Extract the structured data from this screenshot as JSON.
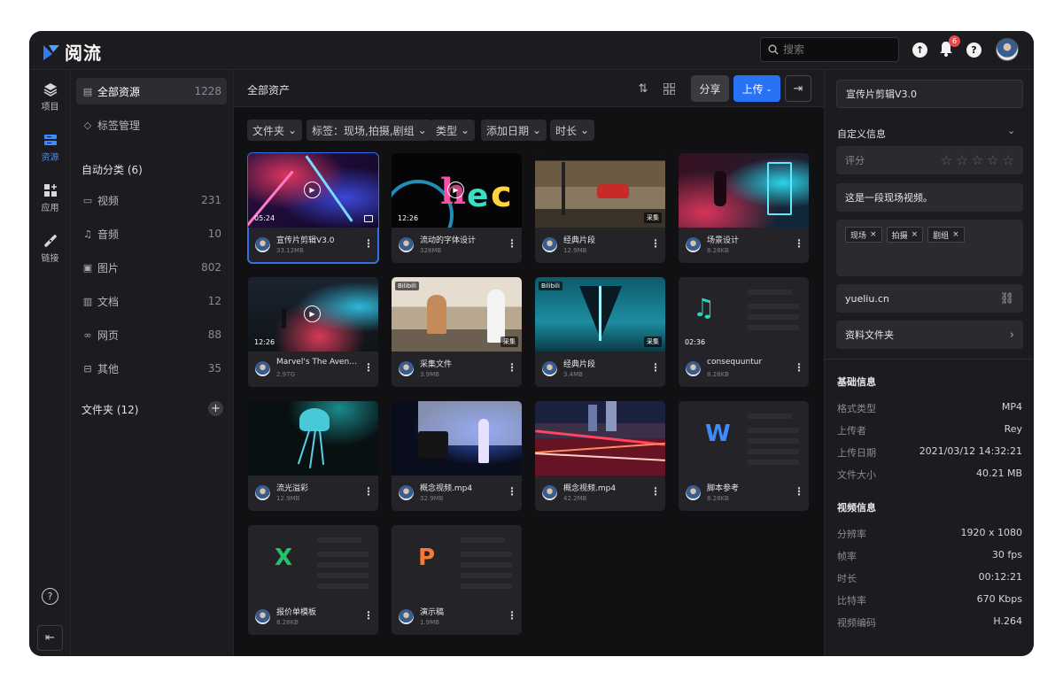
{
  "app": {
    "name": "阅流"
  },
  "topbar": {
    "search_placeholder": "搜索",
    "notification_count": "6"
  },
  "nav": {
    "items": [
      {
        "label": "项目",
        "icon": "layers-icon"
      },
      {
        "label": "资源",
        "icon": "folder-icon"
      },
      {
        "label": "应用",
        "icon": "apps-icon"
      },
      {
        "label": "链接",
        "icon": "link-icon"
      }
    ]
  },
  "sidebar": {
    "all": {
      "label": "全部资源",
      "count": "1228"
    },
    "tags": {
      "label": "标签管理"
    },
    "auto_title": "自动分类 (6)",
    "categories": [
      {
        "label": "视频",
        "count": "231"
      },
      {
        "label": "音频",
        "count": "10"
      },
      {
        "label": "图片",
        "count": "802"
      },
      {
        "label": "文档",
        "count": "12"
      },
      {
        "label": "网页",
        "count": "88"
      },
      {
        "label": "其他",
        "count": "35"
      }
    ],
    "folder_title": "文件夹 (12)"
  },
  "main": {
    "title": "全部资产",
    "share": "分享",
    "upload": "上传",
    "filters": [
      "文件夹",
      "标签：现场,拍摄,剧组",
      "类型",
      "添加日期",
      "时长"
    ],
    "cards": [
      {
        "name": "宣传片剪辑V3.0",
        "size": "33.12MB",
        "duration": "05:24"
      },
      {
        "name": "流动的字体设计",
        "size": "328MB",
        "duration": "12:26"
      },
      {
        "name": "经典片段",
        "size": "12.9MB",
        "badge": "采集"
      },
      {
        "name": "场景设计",
        "size": "8.28KB"
      },
      {
        "name": "Marvel's The Avengers",
        "size": "2.97G",
        "duration": "12:26"
      },
      {
        "name": "采集文件",
        "size": "3.9MB",
        "source": "Bilibili",
        "badge": "采集"
      },
      {
        "name": "经典片段",
        "size": "3.4MB",
        "source": "Bilibili",
        "badge": "采集"
      },
      {
        "name": "consequuntur",
        "size": "8.28KB",
        "duration": "02:36"
      },
      {
        "name": "流光溢彩",
        "size": "12.9MB"
      },
      {
        "name": "概念视频.mp4",
        "size": "32.9MB"
      },
      {
        "name": "概念视频.mp4",
        "size": "42.2MB"
      },
      {
        "name": "脚本参考",
        "size": "8.28KB"
      },
      {
        "name": "报价单模板",
        "size": "8.28KB"
      },
      {
        "name": "演示稿",
        "size": "1.9MB"
      }
    ]
  },
  "detail": {
    "title": "宣传片剪辑V3.0",
    "custom_title": "自定义信息",
    "rating_label": "评分",
    "description": "这是一段现场视频。",
    "tags": [
      "现场",
      "拍摄",
      "剧组"
    ],
    "link": "yueliu.cn",
    "folder": "资料文件夹",
    "basic_title": "基础信息",
    "basic": [
      {
        "k": "格式类型",
        "v": "MP4"
      },
      {
        "k": "上传者",
        "v": "Rey"
      },
      {
        "k": "上传日期",
        "v": "2021/03/12 14:32:21"
      },
      {
        "k": "文件大小",
        "v": "40.21 MB"
      }
    ],
    "video_title": "视频信息",
    "video": [
      {
        "k": "分辨率",
        "v": "1920 x 1080"
      },
      {
        "k": "帧率",
        "v": "30 fps"
      },
      {
        "k": "时长",
        "v": "00:12:21"
      },
      {
        "k": "比特率",
        "v": "670 Kbps"
      },
      {
        "k": "视频编码",
        "v": "H.264"
      }
    ]
  },
  "colors": {
    "accent": "#2a72f5",
    "bg": "#18181c",
    "panel": "#1c1c20"
  }
}
